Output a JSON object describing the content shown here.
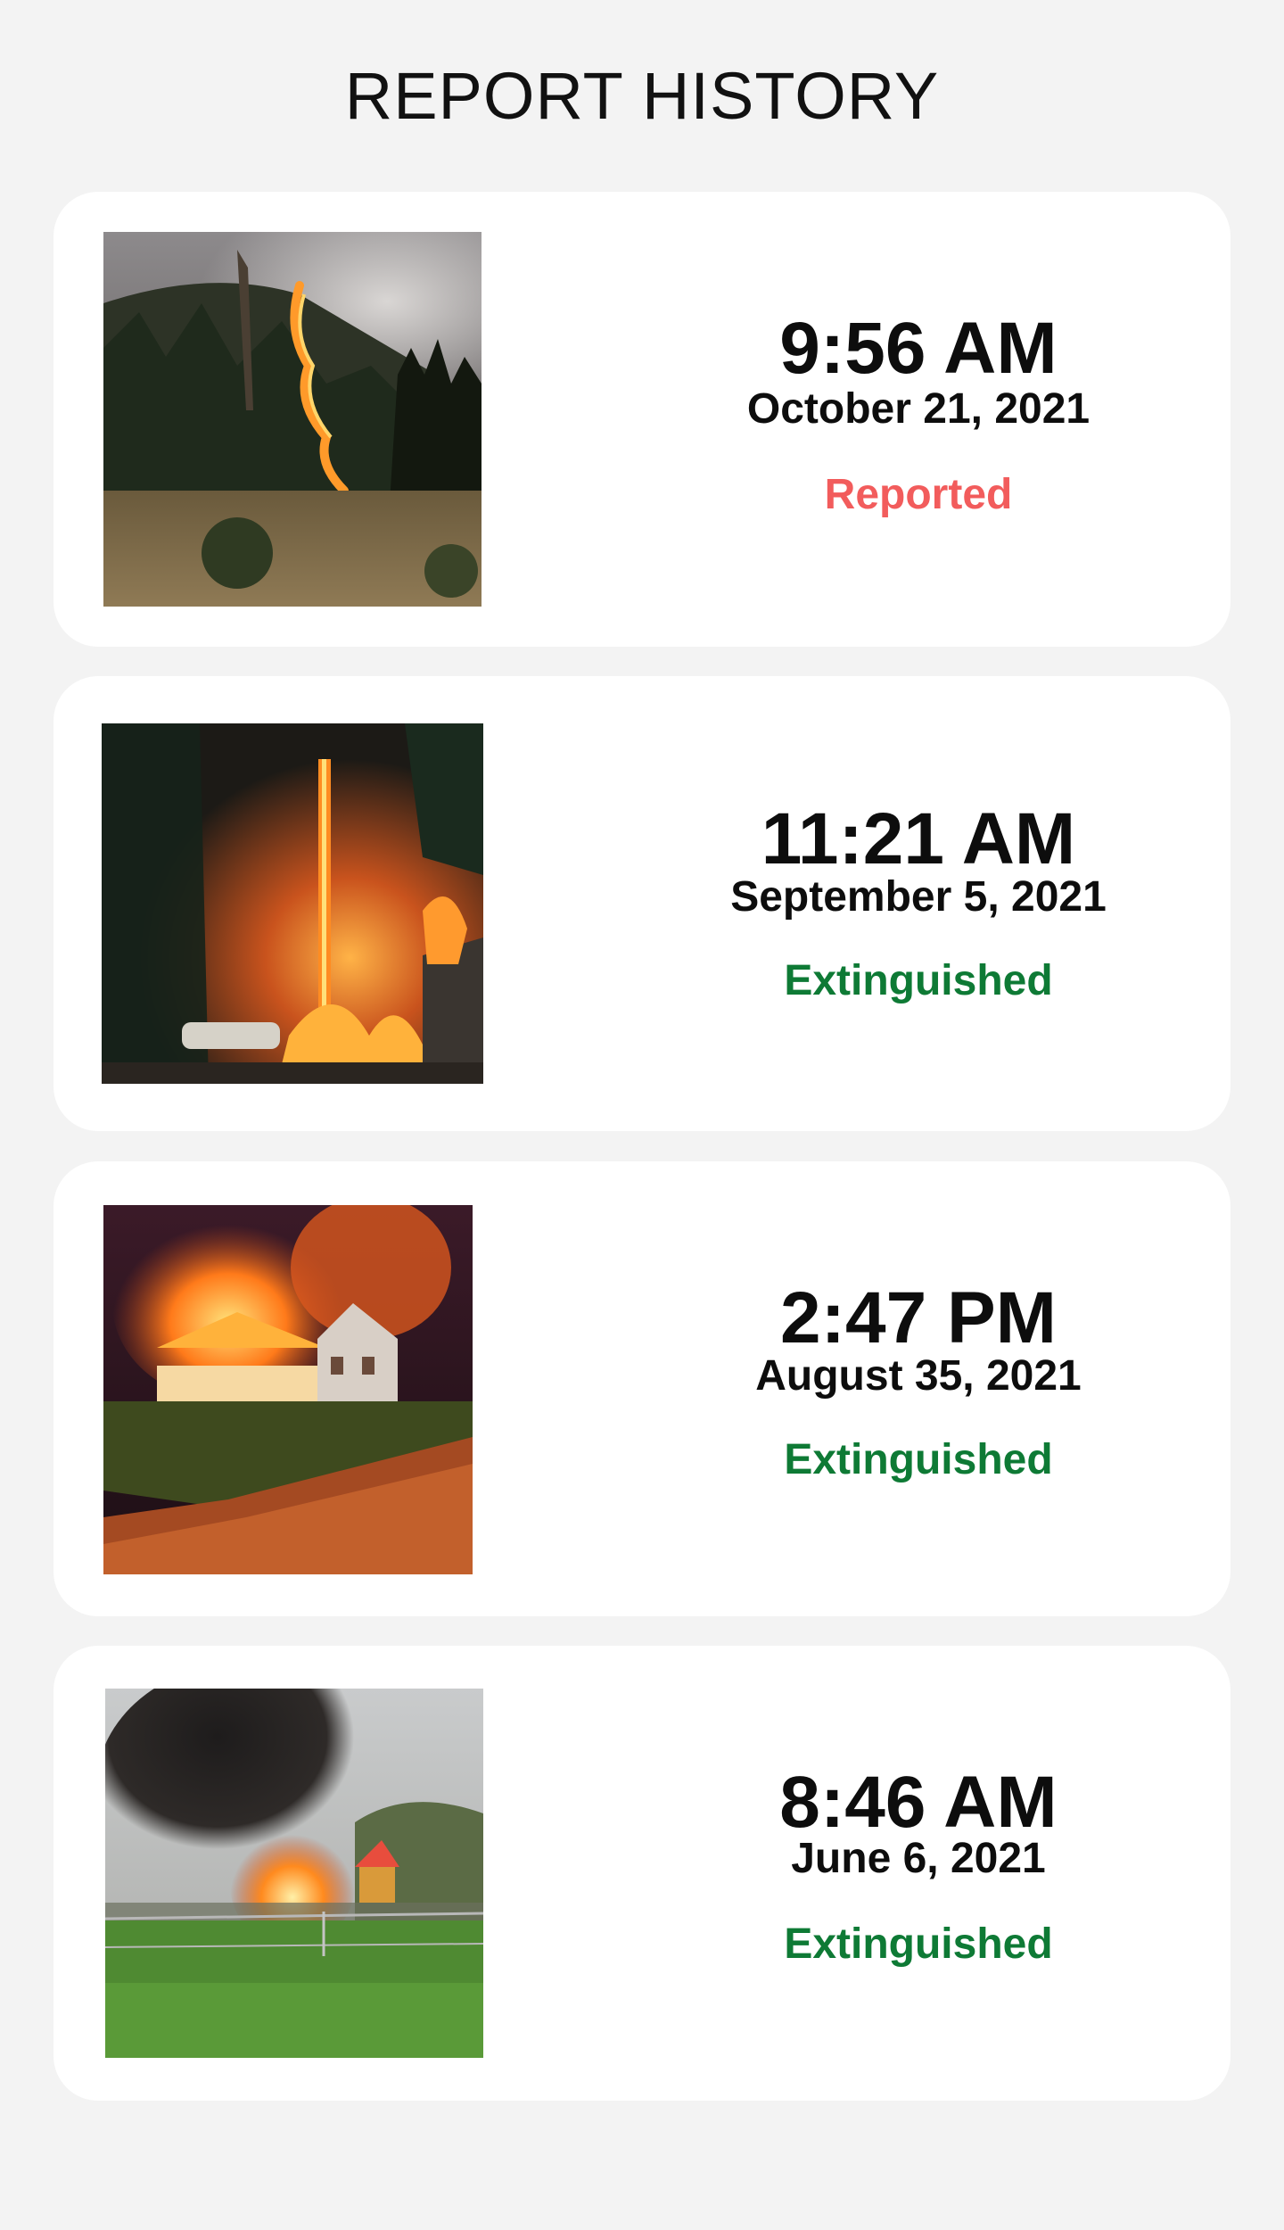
{
  "header": {
    "title": "REPORT HISTORY"
  },
  "colors": {
    "background": "#f3f3f3",
    "card": "#ffffff",
    "reported": "#f25c5c",
    "extinguished": "#0e7a35"
  },
  "reports": [
    {
      "time": "9:56 AM",
      "date": "October 21, 2021",
      "status": "Reported",
      "status_color": "#f25c5c",
      "photo_icon": "forest-fire-photo"
    },
    {
      "time": "11:21 AM",
      "date": "September 5, 2021",
      "status": "Extinguished",
      "status_color": "#0e7a35",
      "photo_icon": "tree-fire-photo"
    },
    {
      "time": "2:47 PM",
      "date": "August 35, 2021",
      "status": "Extinguished",
      "status_color": "#0e7a35",
      "photo_icon": "house-fire-photo"
    },
    {
      "time": "8:46 AM",
      "date": "June 6, 2021",
      "status": "Extinguished",
      "status_color": "#0e7a35",
      "photo_icon": "backyard-fire-photo"
    }
  ]
}
